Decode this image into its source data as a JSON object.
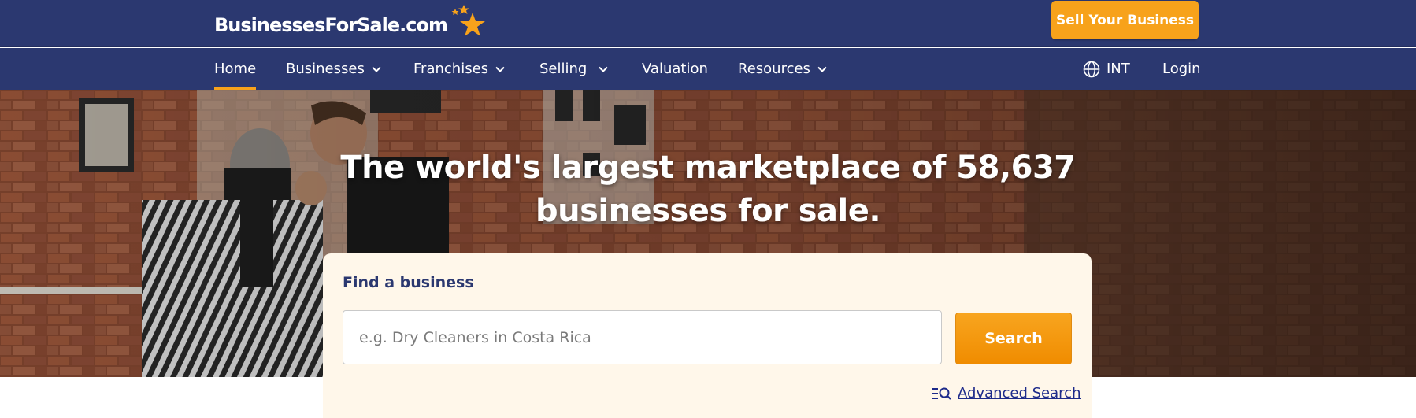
{
  "header": {
    "logo_text": "BusinessesForSale.com",
    "sell_button_label": "Sell Your Business",
    "brand_color": "#2b3870",
    "accent_color": "#f7a21b"
  },
  "nav": {
    "items": [
      {
        "label": "Home",
        "active": true,
        "has_dropdown": false
      },
      {
        "label": "Businesses",
        "active": false,
        "has_dropdown": true
      },
      {
        "label": "Franchises",
        "active": false,
        "has_dropdown": true
      },
      {
        "label": "Selling",
        "active": false,
        "has_dropdown": true
      },
      {
        "label": "Valuation",
        "active": false,
        "has_dropdown": false
      },
      {
        "label": "Resources",
        "active": false,
        "has_dropdown": true
      }
    ],
    "region_label": "INT",
    "login_label": "Login"
  },
  "hero": {
    "title_line1": "The world's largest marketplace of 58,637",
    "title_line2": "businesses for sale."
  },
  "search": {
    "card_title": "Find a business",
    "placeholder": "e.g. Dry Cleaners in Costa Rica",
    "value": "",
    "button_label": "Search",
    "advanced_label": "Advanced Search"
  }
}
